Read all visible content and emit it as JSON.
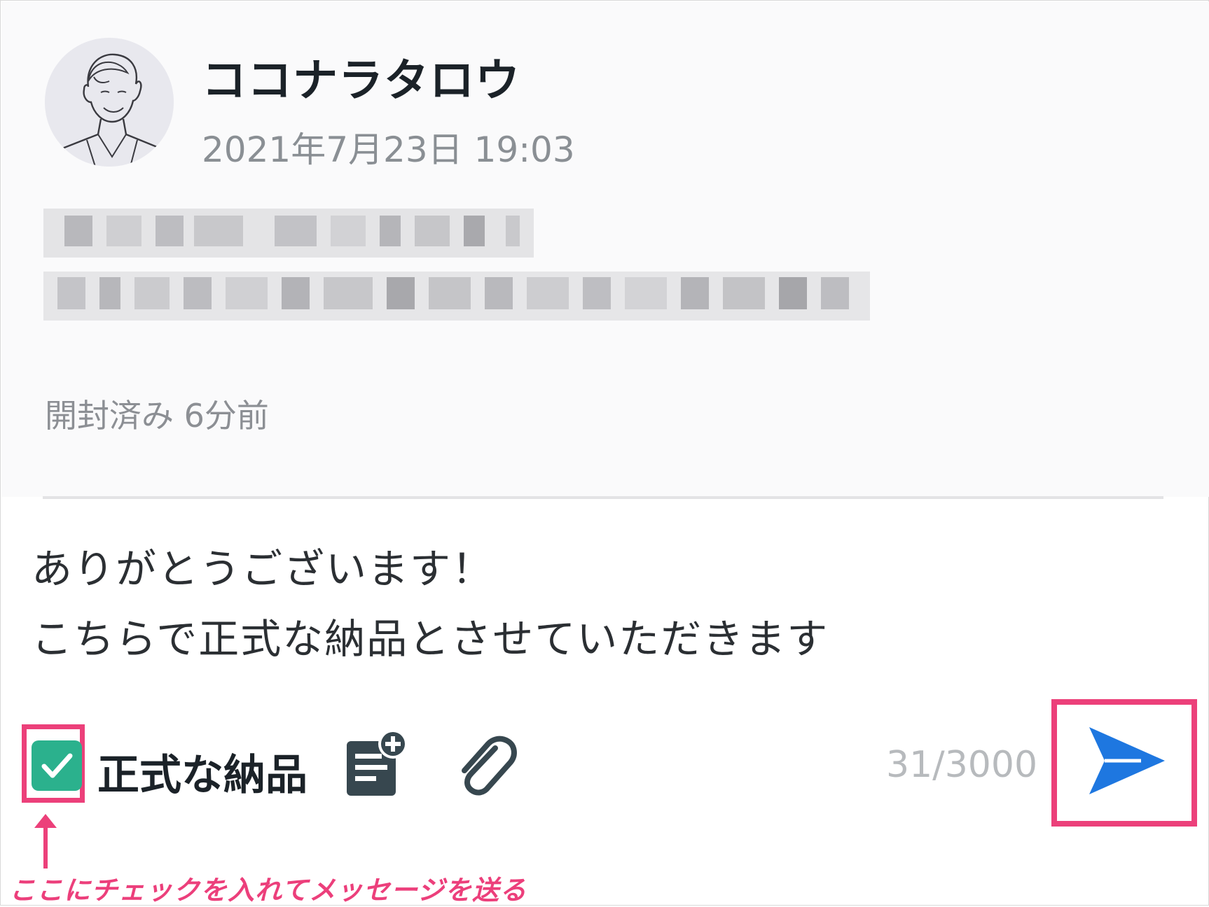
{
  "message": {
    "sender_name": "ココナラタロウ",
    "timestamp": "2021年7月23日 19:03",
    "read_status": "開封済み 6分前"
  },
  "composer": {
    "lines": [
      "ありがとうございます！",
      "こちらで正式な納品とさせていただきます"
    ],
    "char_count": "31/3000"
  },
  "toolbar": {
    "official_delivery_label": "正式な納品",
    "official_delivery_checked": true,
    "icons": [
      "checkbox-checked-icon",
      "template-add-icon",
      "paperclip-icon",
      "send-icon"
    ]
  },
  "annotation": {
    "caption": "ここにチェックを入れてメッセージを送る"
  },
  "colors": {
    "checkbox": "#2bb18d",
    "send": "#1e77e0",
    "highlight": "#ec407a",
    "toolbar_icon": "#37474f"
  }
}
